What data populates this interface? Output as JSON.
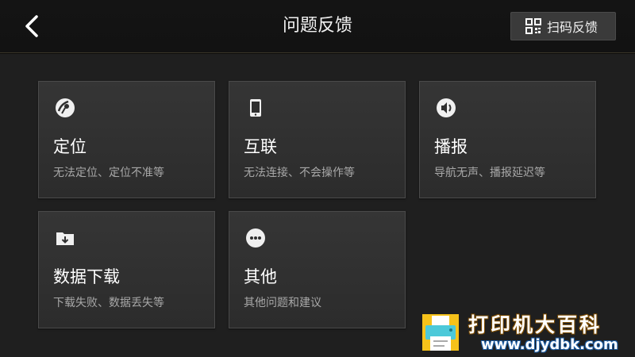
{
  "header": {
    "back_icon": "chevron-left-icon",
    "title": "问题反馈",
    "scan_button": {
      "icon": "qr-code-icon",
      "label": "扫码反馈"
    }
  },
  "categories": [
    {
      "icon": "satellite-dish-icon",
      "title": "定位",
      "subtitle": "无法定位、定位不准等"
    },
    {
      "icon": "phone-icon",
      "title": "互联",
      "subtitle": "无法连接、不会操作等"
    },
    {
      "icon": "speaker-icon",
      "title": "播报",
      "subtitle": "导航无声、播报延迟等"
    },
    {
      "icon": "folder-download-icon",
      "title": "数据下载",
      "subtitle": "下载失败、数据丢失等"
    },
    {
      "icon": "more-dots-icon",
      "title": "其他",
      "subtitle": "其他问题和建议"
    }
  ],
  "watermark": {
    "icon": "printer-logo-icon",
    "text_cn": "打印机大百科",
    "text_url": "www.djydbk.com"
  },
  "colors": {
    "background": "#1f1f1f",
    "header": "#141414",
    "card": "#303030",
    "card_border": "#4a4a4a",
    "subtitle": "#a8a8a8"
  }
}
